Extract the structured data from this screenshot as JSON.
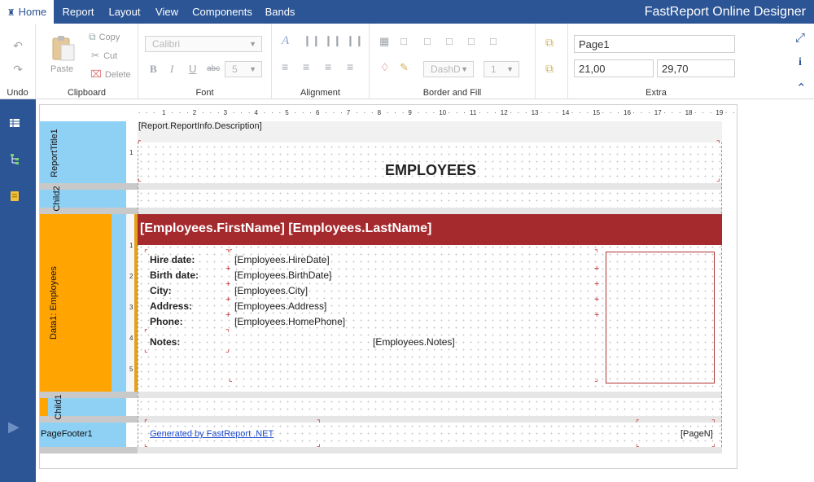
{
  "app": {
    "title": "FastReport Online Designer"
  },
  "menu": {
    "home": "Home",
    "report": "Report",
    "layout": "Layout",
    "view": "View",
    "components": "Components",
    "bands": "Bands"
  },
  "ribbon": {
    "undo_group": "Undo",
    "clipboard_group": "Clipboard",
    "paste": "Paste",
    "copy": "Copy",
    "cut": "Cut",
    "delete": "Delete",
    "font_group": "Font",
    "font_name": "Calibri",
    "font_size": "5",
    "alignment_group": "Alignment",
    "border_group": "Border and Fill",
    "dash_style": "DashD",
    "line_width": "1",
    "extra_group": "Extra",
    "page_name": "Page1",
    "page_width": "21,00",
    "page_height": "29,70"
  },
  "ruler": {
    "ticks": [
      "1",
      "2",
      "3",
      "4",
      "5",
      "6",
      "7",
      "8",
      "9",
      "10",
      "11",
      "12",
      "13",
      "14",
      "15",
      "16",
      "17",
      "18",
      "19"
    ]
  },
  "bands": {
    "report_title": "ReportTitle1",
    "child2": "Child2",
    "data": "Data1: Employees",
    "child1": "Child1",
    "page_footer": "PageFooter1"
  },
  "report": {
    "description": "[Report.ReportInfo.Description]",
    "title": "EMPLOYEES",
    "header": "[Employees.FirstName] [Employees.LastName]",
    "labels": {
      "hire": "Hire date:",
      "birth": "Birth date:",
      "city": "City:",
      "address": "Address:",
      "phone": "Phone:",
      "notes": "Notes:"
    },
    "values": {
      "hire": "[Employees.HireDate]",
      "birth": "[Employees.BirthDate]",
      "city": "[Employees.City]",
      "address": "[Employees.Address]",
      "phone": "[Employees.HomePhone]",
      "notes": "[Employees.Notes]"
    },
    "footer_link": "Generated by FastReport .NET",
    "page_number": "[PageN]"
  },
  "colors": {
    "menubar": "#2c5596",
    "band_blue": "#8fd0f5",
    "band_orange": "#ffa400",
    "header_red": "#a52a2e",
    "link_blue": "#1f4ccf"
  }
}
